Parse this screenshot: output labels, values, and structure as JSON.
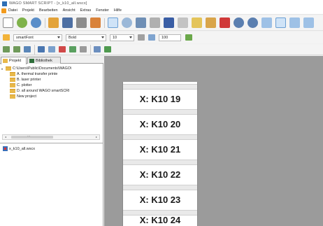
{
  "window": {
    "title": "WAGO SMART SCRIPT - [x_k10_all.wscx]"
  },
  "menu": {
    "items": [
      "Datei",
      "Projekt",
      "Bearbeiten",
      "Ansicht",
      "Extras",
      "Fenster",
      "Hilfe"
    ]
  },
  "format_toolbar": {
    "font": "smartFont",
    "weight": "Bold",
    "size": "10",
    "zoom": "100"
  },
  "left_panel": {
    "tabs": [
      "Projekt",
      "Bibliothek"
    ],
    "tree": {
      "root": "C:\\Users\\Public\\Documents\\WAGO\\",
      "children": [
        "A. thermal transfer printe",
        "B. laser printer",
        "C. plotter",
        "D. all around WAGO smartSCRI",
        "New project"
      ]
    },
    "scrollbar_grip": "...",
    "files": [
      "x_k10_all.wscx"
    ]
  },
  "document": {
    "markers": [
      "X: K10 19",
      "X: K10 20",
      "X: K10 21",
      "X: K10 22",
      "X: K10 23",
      "X: K10 24"
    ]
  },
  "colors": {
    "workspace": "#9b9b9b",
    "folder": "#e8b84a",
    "selected_tool": "#cfe3f7"
  }
}
